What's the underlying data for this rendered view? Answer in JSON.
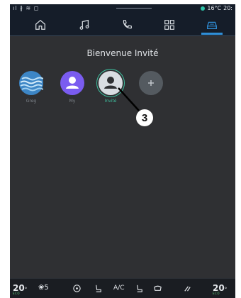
{
  "status": {
    "left_icons": "ıl ∦ ≋ ◻",
    "temperature": "16°C",
    "time": "20:"
  },
  "nav": [
    {
      "name": "home-icon"
    },
    {
      "name": "music-icon"
    },
    {
      "name": "phone-icon"
    },
    {
      "name": "apps-icon"
    },
    {
      "name": "vehicle-icon",
      "active": true
    }
  ],
  "welcome": "Bienvenue Invité",
  "profiles": [
    {
      "label": "Greg",
      "icon": "wave-avatar-icon",
      "color": "#3d86c6"
    },
    {
      "label": "My",
      "icon": "person-avatar-icon",
      "color": "#7a5cf0"
    },
    {
      "label": "Invité",
      "icon": "person-avatar-icon",
      "color": "#d9dde2",
      "selected": true
    },
    {
      "label": "",
      "icon": "add-profile-icon",
      "color": "#545a60"
    }
  ],
  "callout": "3",
  "bottom": {
    "temp_left": "20",
    "temp_left_unit": "°",
    "temp_left_sub": "ECO",
    "fan_speed": "5",
    "ac_label": "A/C",
    "temp_right": "20",
    "temp_right_unit": "°",
    "temp_right_sub": "ECO"
  },
  "colors": {
    "accent": "#2f8fd8",
    "selected_green": "#3fbf9f"
  }
}
